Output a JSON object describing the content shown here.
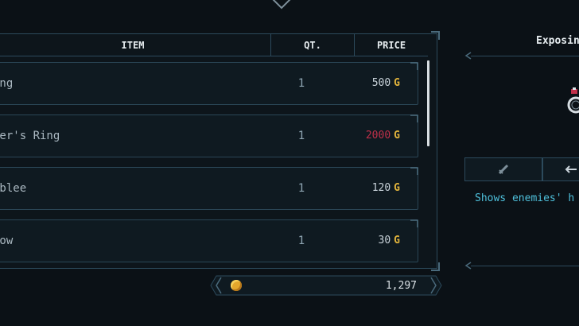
{
  "shop": {
    "columns": {
      "item": "ITEM",
      "qty": "QT.",
      "price": "PRICE"
    },
    "rows": [
      {
        "name": "ing",
        "qty": "1",
        "price": "500",
        "currency": "G",
        "price_color": "#c9d3da"
      },
      {
        "name": "her's Ring",
        "qty": "1",
        "price": "2000",
        "currency": "G",
        "price_color": "#c0304a"
      },
      {
        "name": "ublee",
        "qty": "1",
        "price": "120",
        "currency": "G",
        "price_color": "#c9d3da"
      },
      {
        "name": "row",
        "qty": "1",
        "price": "30",
        "currency": "G",
        "price_color": "#c9d3da"
      }
    ]
  },
  "gold": {
    "amount": "1,297",
    "icon": "gold-coin-icon"
  },
  "details": {
    "title": "Exposin",
    "description": "Shows enemies' h",
    "tabs": [
      {
        "icon": "sword-icon"
      },
      {
        "icon": "arrow-icon"
      }
    ],
    "icon": "ring-icon"
  },
  "colors": {
    "accent": "#4fc1dc",
    "currency": "#e3b53c",
    "border": "#2c4a5c",
    "expensive": "#c0304a"
  }
}
